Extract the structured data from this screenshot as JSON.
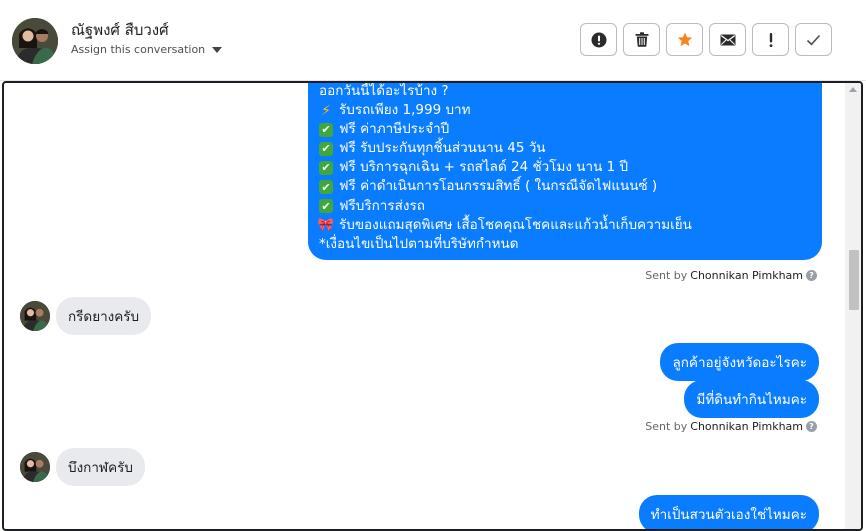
{
  "header": {
    "contact_name": "ณัฐพงศ์ สืบวงศ์",
    "assign_label": "Assign this conversation",
    "actions": [
      {
        "name": "mark-spam",
        "icon": "alert-circle-icon"
      },
      {
        "name": "delete",
        "icon": "trash-icon"
      },
      {
        "name": "star",
        "icon": "star-icon"
      },
      {
        "name": "mark-unread",
        "icon": "envelope-icon"
      },
      {
        "name": "important",
        "icon": "exclamation-icon"
      },
      {
        "name": "mark-done",
        "icon": "check-icon"
      }
    ],
    "star_color": "#f5841f"
  },
  "messages": {
    "promo": {
      "lines": [
        {
          "emoji": "",
          "text": "ออกวันนี้ได้อะไรบ้าง ?"
        },
        {
          "emoji": "lightning-icon",
          "text": "รับรถเพียง 1,999 บาท"
        },
        {
          "emoji": "check-box-icon",
          "text": "ฟรี ค่าภาษีประจำปี"
        },
        {
          "emoji": "check-box-icon",
          "text": "ฟรี รับประกันทุกชิ้นส่วนนาน 45 วัน"
        },
        {
          "emoji": "check-box-icon",
          "text": "ฟรี บริการฉุกเฉิน + รถสไลด์ 24 ชั่วโมง นาน 1 ปี"
        },
        {
          "emoji": "check-box-icon",
          "text": "ฟรี ค่าดำเนินการโอนกรรมสิทธิ์ ( ในกรณีจัดไฟแนนซ์ )"
        },
        {
          "emoji": "check-box-icon",
          "text": "ฟรีบริการส่งรถ"
        },
        {
          "emoji": "ribbon-icon",
          "text": "รับของแถมสุดพิเศษ เสื้อโชคคุณโชคและแก้วน้ำเก็บความเย็น"
        },
        {
          "emoji": "",
          "text": "*เงื่อนไขเป็นไปตามที่บริษัทกำหนด"
        }
      ]
    },
    "sent_by_prefix": "Sent by",
    "sent_by_agent": "Chonnikan Pimkham",
    "in_1": "กรีดยางครับ",
    "out_1": "ลูกค้าอยู่จังหวัดอะไรคะ",
    "out_2": "มีที่ดินทำกินไหมคะ",
    "in_2": "บึงกาฬครับ",
    "out_3": "ทำเป็นสวนตัวเองใช่ไหมคะ"
  },
  "colors": {
    "outgoing_bubble": "#0a7cff",
    "incoming_bubble": "#e9eaed",
    "check_emoji": "#3ea83a"
  }
}
